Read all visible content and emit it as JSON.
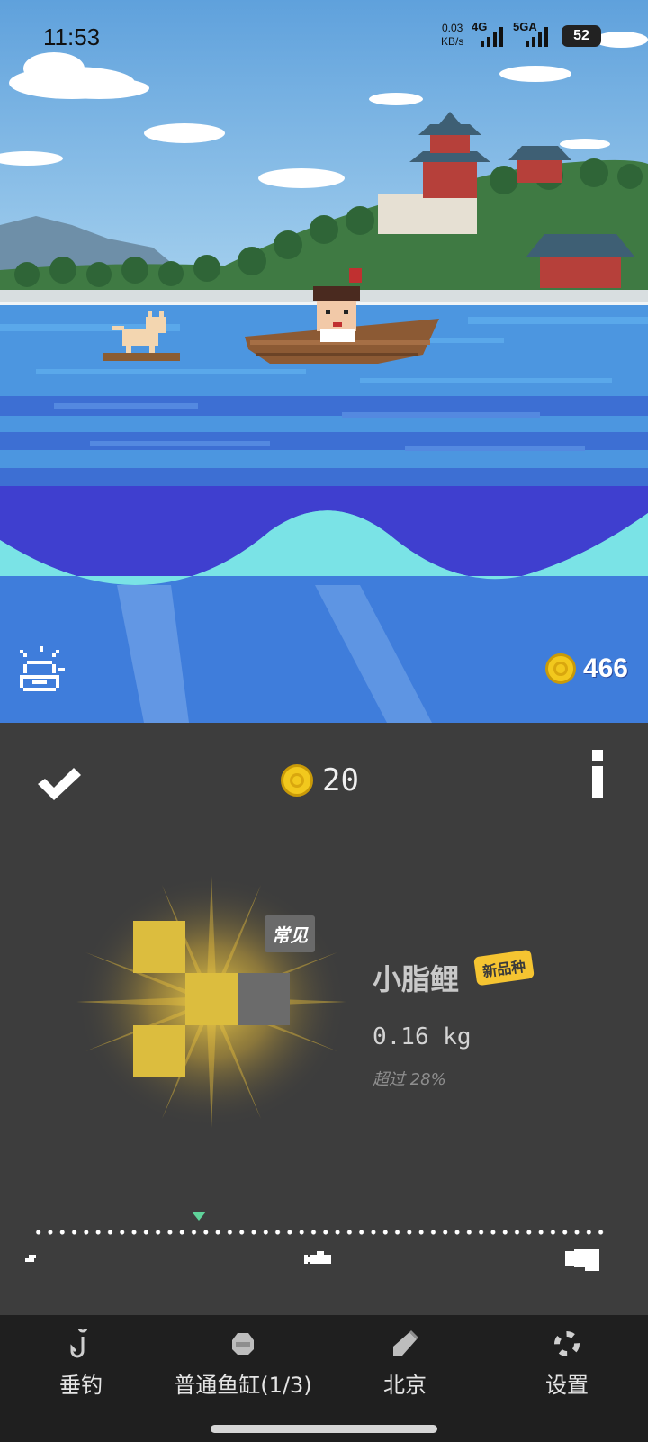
{
  "status_bar": {
    "time": "11:53",
    "net_speed_value": "0.03",
    "net_speed_unit": "KB/s",
    "network_1": "4G",
    "network_2": "5GA",
    "battery": "52"
  },
  "scene": {
    "location_art": "pixel-art lakeside palace with boat",
    "weather_icon": "weather-icon",
    "total_coins": "466"
  },
  "catch_result": {
    "reward_coins": "20",
    "rarity": "常见",
    "fish_name": "小脂鲤",
    "new_badge": "新品种",
    "weight": "0.16 kg",
    "percentile_text": "超过 28%",
    "size_scale_position": 0.29,
    "colors": {
      "fish_primary": "#dcbd3e",
      "fish_secondary": "#6b6b6b",
      "badge_yellow": "#f5c431",
      "marker_green": "#5fd39a"
    }
  },
  "bottom_nav": {
    "items": [
      {
        "label": "垂钓",
        "icon": "fishing-hook-icon"
      },
      {
        "label": "普通鱼缸(1/3)",
        "icon": "fish-tank-icon"
      },
      {
        "label": "北京",
        "icon": "location-bottle-icon"
      },
      {
        "label": "设置",
        "icon": "settings-lifebuoy-icon"
      }
    ]
  }
}
